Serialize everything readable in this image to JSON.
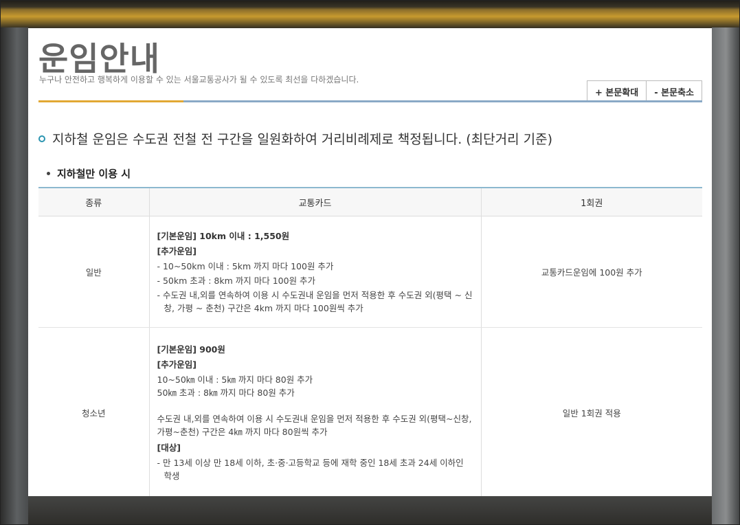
{
  "page": {
    "title": "운임안내",
    "subtitle": "누구나 안전하고 행복하게 이용할 수 있는 서울교통공사가 될 수 있도록 최선을 다하겠습니다.",
    "zoom_in_label": "+ 본문확대",
    "zoom_out_label": "- 본문축소"
  },
  "content": {
    "headline": "지하철 운임은 수도권 전철 전 구간을 일원화하여 거리비례제로 책정됩니다. (최단거리 기준)",
    "section_title": "지하철만 이용 시"
  },
  "table": {
    "headers": [
      "종류",
      "교통카드",
      "1회권"
    ],
    "rows": [
      {
        "type": "일반",
        "base": "[기본운임] 10km 이내 : 1,550원",
        "extra_title": "[추가운임]",
        "items": [
          "- 10~50km 이내 : 5km 까지 마다 100원 추가",
          "- 50km 초과 : 8km 까지 마다 100원 추가",
          "- 수도권 내,외를 연속하여 이용 시 수도권내 운임을 먼저 적용한 후 수도권 외(평택 ~ 신창, 가평 ~ 춘천) 구간은 4km 까지 마다 100원씩 추가"
        ],
        "single": "교통카드운임에 100원 추가"
      },
      {
        "type": "청소년",
        "base": "[기본운임] 900원",
        "extra_title": "[추가운임]",
        "lines": [
          "10~50㎞ 이내 : 5㎞ 까지 마다 80원 추가",
          "50㎞ 초과 : 8㎞ 까지 마다 80원 추가",
          "수도권 내,외를 연속하여 이용 시 수도권내 운임을 먼저 적용한 후 수도권 외(평택~신창, 가평~춘천) 구간은 4㎞ 까지 마다 80원씩 추가"
        ],
        "target_title": "[대상]",
        "target": "- 만 13세 이상 만 18세 이하, 초·중·고등학교 등에 재학 중인 18세 초과 24세 이하인 학생",
        "single": "일반 1회권 적용"
      }
    ]
  }
}
